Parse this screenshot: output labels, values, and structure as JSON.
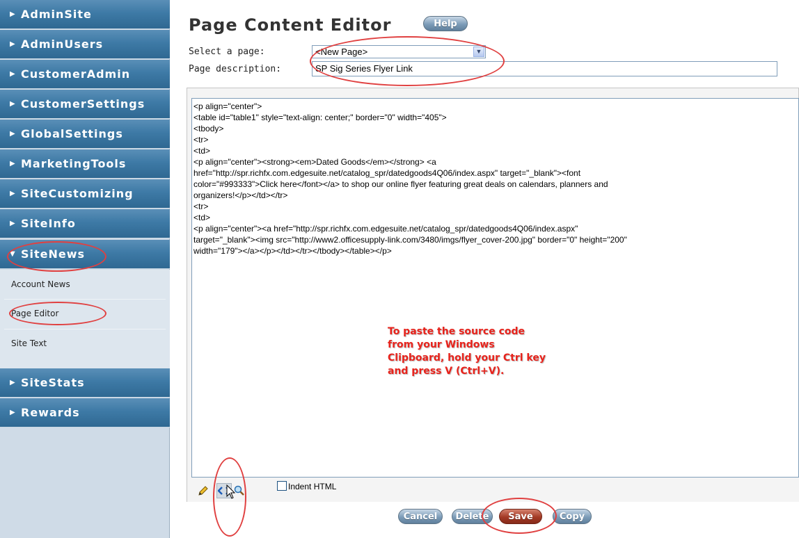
{
  "sidebar": {
    "items": [
      {
        "label": "AdminSite"
      },
      {
        "label": "AdminUsers"
      },
      {
        "label": "CustomerAdmin"
      },
      {
        "label": "CustomerSettings"
      },
      {
        "label": "GlobalSettings"
      },
      {
        "label": "MarketingTools"
      },
      {
        "label": "SiteCustomizing"
      },
      {
        "label": "SiteInfo"
      },
      {
        "label": "SiteNews",
        "expanded": true
      },
      {
        "label": "SiteStats"
      },
      {
        "label": "Rewards"
      }
    ],
    "subitems": [
      {
        "label": "Account News"
      },
      {
        "label": "Page Editor",
        "selected": true
      },
      {
        "label": "Site Text"
      }
    ]
  },
  "header": {
    "title": "Page Content Editor",
    "help_label": "Help"
  },
  "form": {
    "select_label": "Select a page:",
    "select_value": "<New Page>",
    "description_label": "Page description:",
    "description_value": "SP Sig Series Flyer Link"
  },
  "editor": {
    "content": "<p align=\"center\">\n<table id=\"table1\" style=\"text-align: center;\" border=\"0\" width=\"405\">\n<tbody>\n<tr>\n<td>\n<p align=\"center\"><strong><em>Dated Goods</em></strong> <a\nhref=\"http://spr.richfx.com.edgesuite.net/catalog_spr/datedgoods4Q06/index.aspx\" target=\"_blank\"><font\ncolor=\"#993333\">Click here</font></a> to shop our online flyer featuring great deals on calendars, planners and\norganizers!</p></td></tr>\n<tr>\n<td>\n<p align=\"center\"><a href=\"http://spr.richfx.com.edgesuite.net/catalog_spr/datedgoods4Q06/index.aspx\"\ntarget=\"_blank\"><img src=\"http://www2.officesupply-link.com/3480/imgs/flyer_cover-200.jpg\" border=\"0\" height=\"200\"\nwidth=\"179\"></a></p></td></tr></tbody></table></p>",
    "callout_lines": [
      "To paste the source code",
      "from your Windows",
      "Clipboard, hold your Ctrl key",
      "and press V (Ctrl+V)."
    ]
  },
  "toolbar": {
    "indent_label": "Indent HTML",
    "icons": [
      "pencil-icon",
      "code-view-icon",
      "magnifier-icon"
    ]
  },
  "actions": {
    "cancel_label": "Cancel",
    "delete_label": "Delete",
    "save_label": "Save",
    "copy_label": "Copy"
  },
  "colors": {
    "nav_blue": "#3e7aa6",
    "highlight_red": "#e04040",
    "callout_red": "#e8231c",
    "save_red": "#a33a25"
  }
}
